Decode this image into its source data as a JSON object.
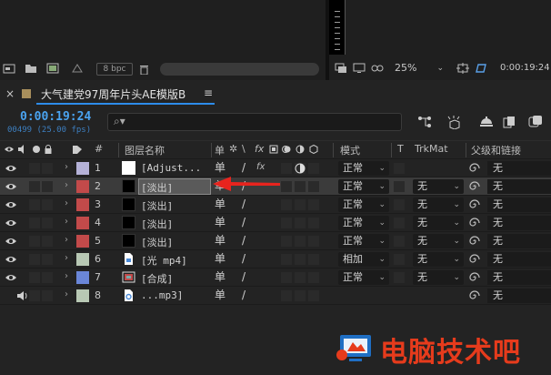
{
  "top_panel": {
    "bpc_label": "8 bpc",
    "zoom_value": "25%",
    "viewer_timecode": "0:00:19:24"
  },
  "comp_tab": {
    "close_glyph": "×",
    "title": "大气建党97周年片头AE模版B",
    "menu_glyph": "≡",
    "swatch_color": "#a88f5c"
  },
  "comp_header": {
    "timecode": "0:00:19:24",
    "frame_info": "00499 (25.00 fps)",
    "search_glyph": "⌕▾"
  },
  "columns": {
    "number": "#",
    "layer_name": "图层名称",
    "mode": "模式",
    "t": "T",
    "trkmat": "TrkMat",
    "parent": "父级和链接"
  },
  "layers": [
    {
      "num": "1",
      "name": "[Adjust...",
      "label_color": "#b5b2d8",
      "thumb": "white",
      "switch1": "单",
      "switch2": "/",
      "fx": "fx",
      "mode": "正常",
      "trkmat": "",
      "parent": "无",
      "has_eye": true,
      "selected": false
    },
    {
      "num": "2",
      "name": "[淡出]",
      "label_color": "#c24a4a",
      "thumb": "black",
      "switch1": "单",
      "switch2": "/",
      "fx": "",
      "mode": "正常",
      "trkmat": "无",
      "parent": "无",
      "has_eye": true,
      "selected": true
    },
    {
      "num": "3",
      "name": "[淡出]",
      "label_color": "#c24a4a",
      "thumb": "black",
      "switch1": "单",
      "switch2": "/",
      "fx": "",
      "mode": "正常",
      "trkmat": "无",
      "parent": "无",
      "has_eye": true,
      "selected": false
    },
    {
      "num": "4",
      "name": "[淡出]",
      "label_color": "#c24a4a",
      "thumb": "black",
      "switch1": "单",
      "switch2": "/",
      "fx": "",
      "mode": "正常",
      "trkmat": "无",
      "parent": "无",
      "has_eye": true,
      "selected": false
    },
    {
      "num": "5",
      "name": "[淡出]",
      "label_color": "#c24a4a",
      "thumb": "black",
      "switch1": "单",
      "switch2": "/",
      "fx": "",
      "mode": "正常",
      "trkmat": "无",
      "parent": "无",
      "has_eye": true,
      "selected": false
    },
    {
      "num": "6",
      "name": "[光 mp4]",
      "label_color": "#b8c8b4",
      "thumb": "file",
      "switch1": "单",
      "switch2": "/",
      "fx": "",
      "mode": "相加",
      "trkmat": "无",
      "parent": "无",
      "has_eye": true,
      "selected": false
    },
    {
      "num": "7",
      "name": "[合成]",
      "label_color": "#6a86d8",
      "thumb": "comp",
      "switch1": "单",
      "switch2": "/",
      "fx": "",
      "mode": "正常",
      "trkmat": "无",
      "parent": "无",
      "has_eye": true,
      "selected": false
    },
    {
      "num": "8",
      "name": "...mp3]",
      "label_color": "#b8c8b4",
      "thumb": "audio",
      "switch1": "单",
      "switch2": "/",
      "fx": "",
      "mode": "",
      "trkmat": "",
      "parent": "无",
      "has_eye": false,
      "selected": false
    }
  ],
  "watermark": {
    "text": "电脑技术吧",
    "color": "#e63b1c"
  },
  "icons": [
    "eye-icon",
    "speaker-icon",
    "solo-icon",
    "lock-icon",
    "label-tag-icon",
    "shy-icon",
    "collapse-icon",
    "quality-icon",
    "fx-icon",
    "motion-blur-icon",
    "adjustment-icon",
    "3d-icon",
    "pickwhip-icon",
    "trash-icon",
    "folder-icon",
    "search-icon"
  ]
}
